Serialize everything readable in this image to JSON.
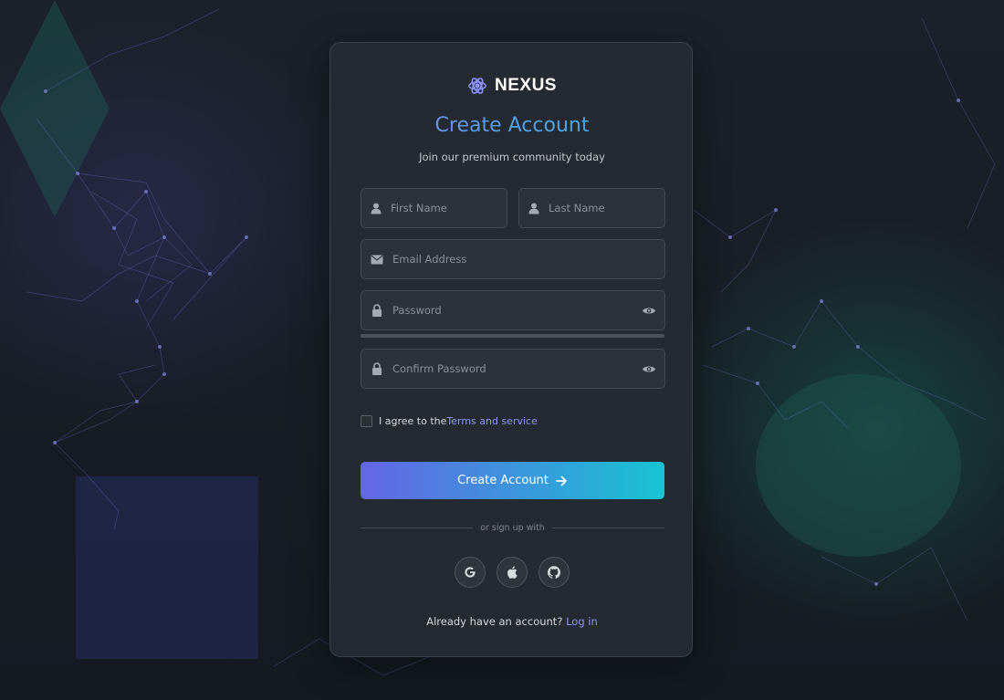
{
  "brand": {
    "name": "NEXUS",
    "logo_icon": "atom-gear-icon",
    "accent": "#7b86f0"
  },
  "header": {
    "title": "Create Account",
    "subtitle": "Join our premium community today"
  },
  "form": {
    "first_name": {
      "placeholder": "First Name",
      "value": "",
      "icon": "user-icon"
    },
    "last_name": {
      "placeholder": "Last Name",
      "value": "",
      "icon": "user-icon"
    },
    "email": {
      "placeholder": "Email Address",
      "value": "",
      "icon": "envelope-icon"
    },
    "password": {
      "placeholder": "Password",
      "value": "",
      "icon": "lock-icon",
      "toggle_icon": "eye-icon"
    },
    "confirm_password": {
      "placeholder": "Confirm Password",
      "value": "",
      "icon": "lock-icon",
      "toggle_icon": "eye-icon"
    },
    "terms": {
      "checked": false,
      "prefix": "I agree to the",
      "link_text": "Terms and service"
    },
    "submit": {
      "label": "Create Account",
      "icon": "arrow-right-icon"
    }
  },
  "divider": {
    "text": "or sign up with"
  },
  "social": [
    {
      "name": "google",
      "icon": "google-icon"
    },
    {
      "name": "apple",
      "icon": "apple-icon"
    },
    {
      "name": "github",
      "icon": "github-icon"
    }
  ],
  "footer": {
    "prompt": "Already have an account?",
    "link_text": "Log in"
  },
  "colors": {
    "gradient_start": "#6366e6",
    "gradient_end": "#17c3d3",
    "link": "#8f95f4",
    "card_bg": "#262b33"
  }
}
